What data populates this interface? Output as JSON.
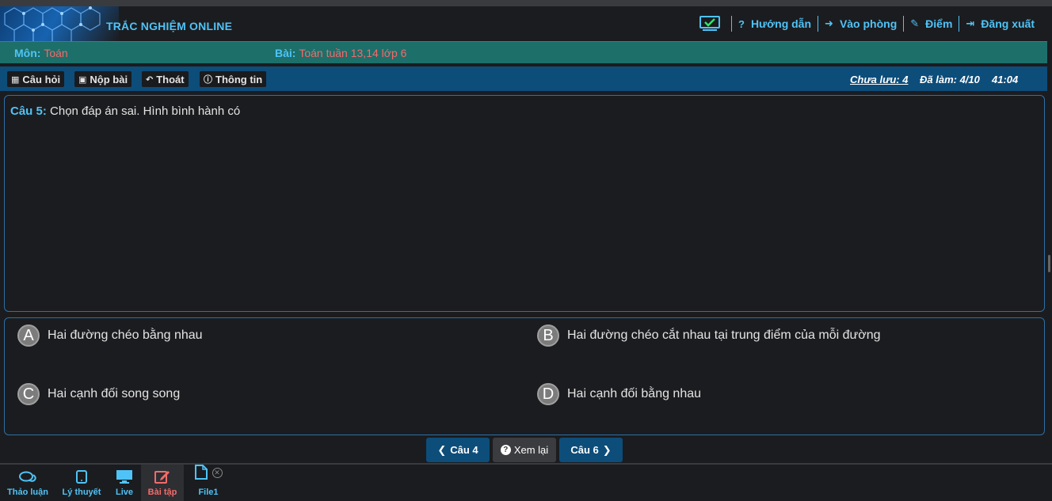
{
  "header": {
    "app_title": "TRẮC NGHIỆM ONLINE",
    "nav": [
      {
        "icon": "question-icon",
        "label": "Hướng dẫn"
      },
      {
        "icon": "sign-in-icon",
        "label": "Vào phòng"
      },
      {
        "icon": "edit-icon",
        "label": "Điểm"
      },
      {
        "icon": "sign-out-icon",
        "label": "Đăng xuất"
      }
    ]
  },
  "subject": {
    "label": "Môn:",
    "value": "Toán"
  },
  "lesson": {
    "label": "Bài:",
    "value": "Toán tuần 13,14 lớp 6"
  },
  "toolbar": {
    "questions_label": "Câu hỏi",
    "submit_label": "Nộp bài",
    "exit_label": "Thoát",
    "info_label": "Thông tin",
    "unsaved": "Chưa lưu: 4",
    "done": "Đã làm: 4/10",
    "timer": "41:04"
  },
  "question": {
    "number": "Câu 5:",
    "text": "Chọn đáp án sai. Hình bình hành có"
  },
  "answers": [
    {
      "letter": "A",
      "text": "Hai đường chéo bằng nhau"
    },
    {
      "letter": "B",
      "text": "Hai đường chéo cắt nhau tại trung điểm của mỗi đường"
    },
    {
      "letter": "C",
      "text": "Hai cạnh đối song song"
    },
    {
      "letter": "D",
      "text": "Hai cạnh đối bằng nhau"
    }
  ],
  "navigation": {
    "prev_label": "Câu 4",
    "review_label": "Xem lại",
    "next_label": "Câu 6"
  },
  "bottom_tabs": [
    {
      "label": "Thảo luận",
      "icon": "comments-icon"
    },
    {
      "label": "Lý thuyết",
      "icon": "tablet-icon"
    },
    {
      "label": "Live",
      "icon": "monitor-icon"
    },
    {
      "label": "Bài tập",
      "icon": "edit-icon",
      "active": true
    },
    {
      "label": "File1",
      "icon": "file-icon"
    }
  ],
  "colors": {
    "accent": "#4fc3f7",
    "highlight": "#f26b6b",
    "toolbar": "#0d4d7a",
    "subbar": "#1d6f6a"
  }
}
